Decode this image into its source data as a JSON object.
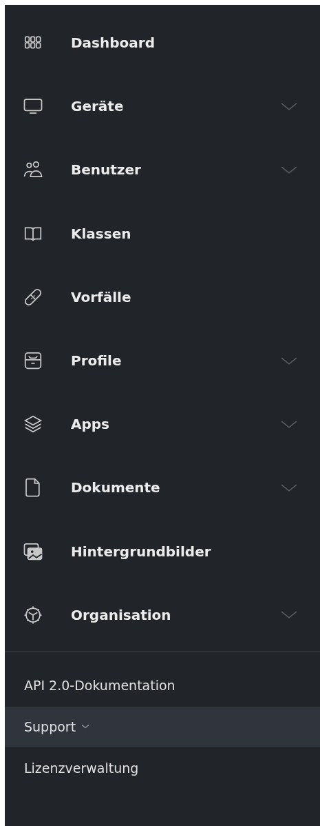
{
  "nav_items": [
    {
      "label": "Dashboard",
      "expandable": false
    },
    {
      "label": "Geräte",
      "expandable": true
    },
    {
      "label": "Benutzer",
      "expandable": true
    },
    {
      "label": "Klassen",
      "expandable": false
    },
    {
      "label": "Vorfälle",
      "expandable": false
    },
    {
      "label": "Profile",
      "expandable": true
    },
    {
      "label": "Apps",
      "expandable": true
    },
    {
      "label": "Dokumente",
      "expandable": true
    },
    {
      "label": "Hintergrundbilder",
      "expandable": false
    },
    {
      "label": "Organisation",
      "expandable": true
    }
  ],
  "footer_links": [
    {
      "label": "API 2.0-Dokumentation",
      "expandable": false,
      "highlighted": false
    },
    {
      "label": "Support",
      "expandable": true,
      "highlighted": true
    },
    {
      "label": "Lizenzverwaltung",
      "expandable": false,
      "highlighted": false
    }
  ]
}
